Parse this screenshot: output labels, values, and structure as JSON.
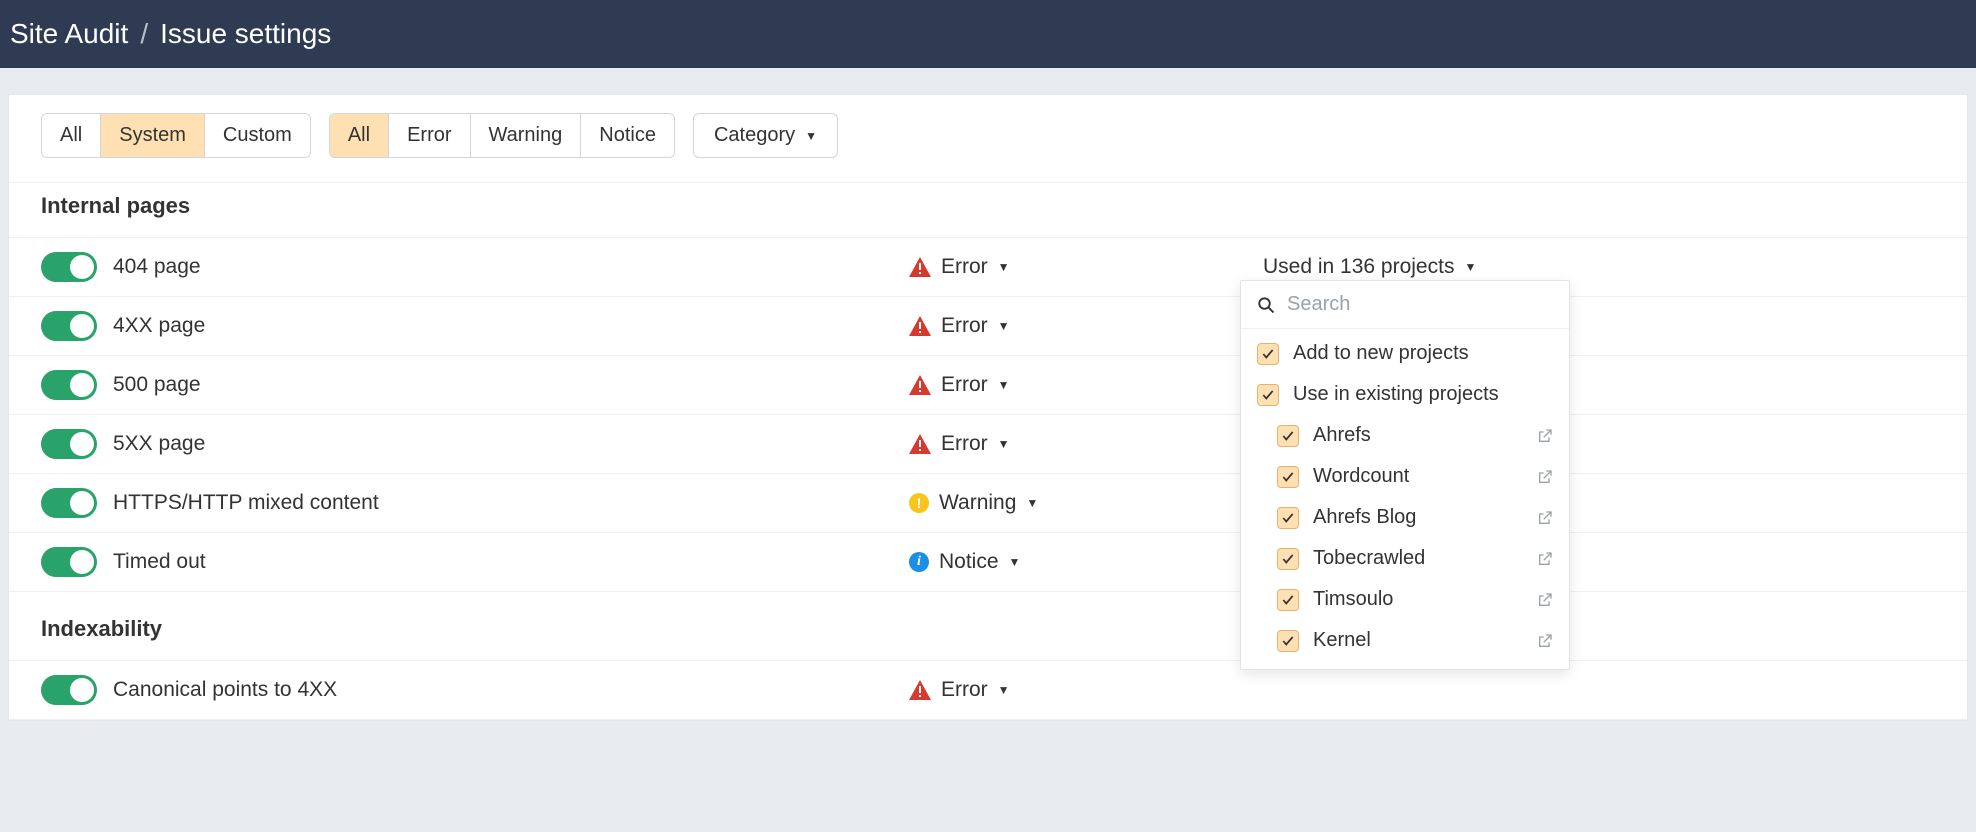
{
  "breadcrumb": {
    "parent": "Site Audit",
    "current": "Issue settings"
  },
  "filters": {
    "source": {
      "all": "All",
      "system": "System",
      "custom": "Custom"
    },
    "severity": {
      "all": "All",
      "error": "Error",
      "warning": "Warning",
      "notice": "Notice"
    },
    "category_label": "Category"
  },
  "sections": [
    {
      "title": "Internal pages",
      "issues": [
        {
          "name": "404 page",
          "severity": "Error",
          "projects": "Used in 136 projects"
        },
        {
          "name": "4XX page",
          "severity": "Error"
        },
        {
          "name": "500 page",
          "severity": "Error"
        },
        {
          "name": "5XX page",
          "severity": "Error"
        },
        {
          "name": "HTTPS/HTTP mixed content",
          "severity": "Warning"
        },
        {
          "name": "Timed out",
          "severity": "Notice"
        }
      ]
    },
    {
      "title": "Indexability",
      "issues": [
        {
          "name": "Canonical points to 4XX",
          "severity": "Error"
        }
      ]
    }
  ],
  "popover": {
    "search_placeholder": "Search",
    "add_label": "Add to new projects",
    "use_label": "Use in existing projects",
    "projects": [
      "Ahrefs",
      "Wordcount",
      "Ahrefs Blog",
      "Tobecrawled",
      "Timsoulo",
      "Kernel"
    ]
  }
}
